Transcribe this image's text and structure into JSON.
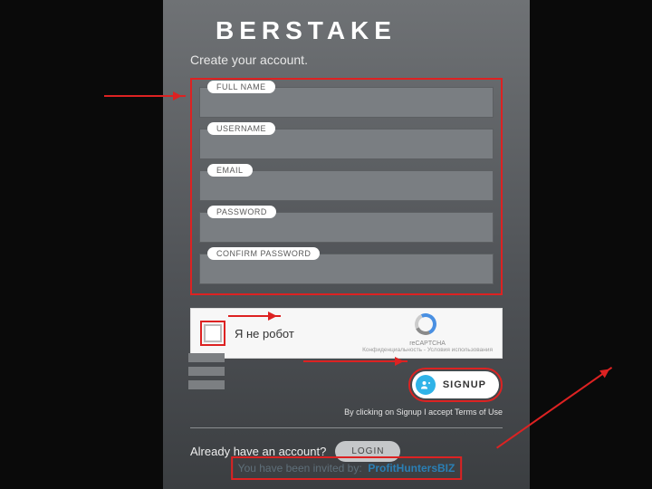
{
  "brand": "BERSTAKE",
  "subtitle": "Create your account.",
  "fields": {
    "fullname": "FULL NAME",
    "username": "USERNAME",
    "email": "EMAIL",
    "password": "PASSWORD",
    "confirm": "CONFIRM PASSWORD"
  },
  "captcha": {
    "label": "Я не робот",
    "brand": "reCAPTCHA",
    "privacy": "Конфиденциальность - Условия использования"
  },
  "signup": {
    "label": "SIGNUP",
    "terms": "By clicking on Signup I accept Terms of Use"
  },
  "login": {
    "question": "Already have an account?",
    "button": "LOGIN"
  },
  "invited": {
    "prefix": "You have been invited by:",
    "referrer": "ProfitHuntersBIZ"
  }
}
